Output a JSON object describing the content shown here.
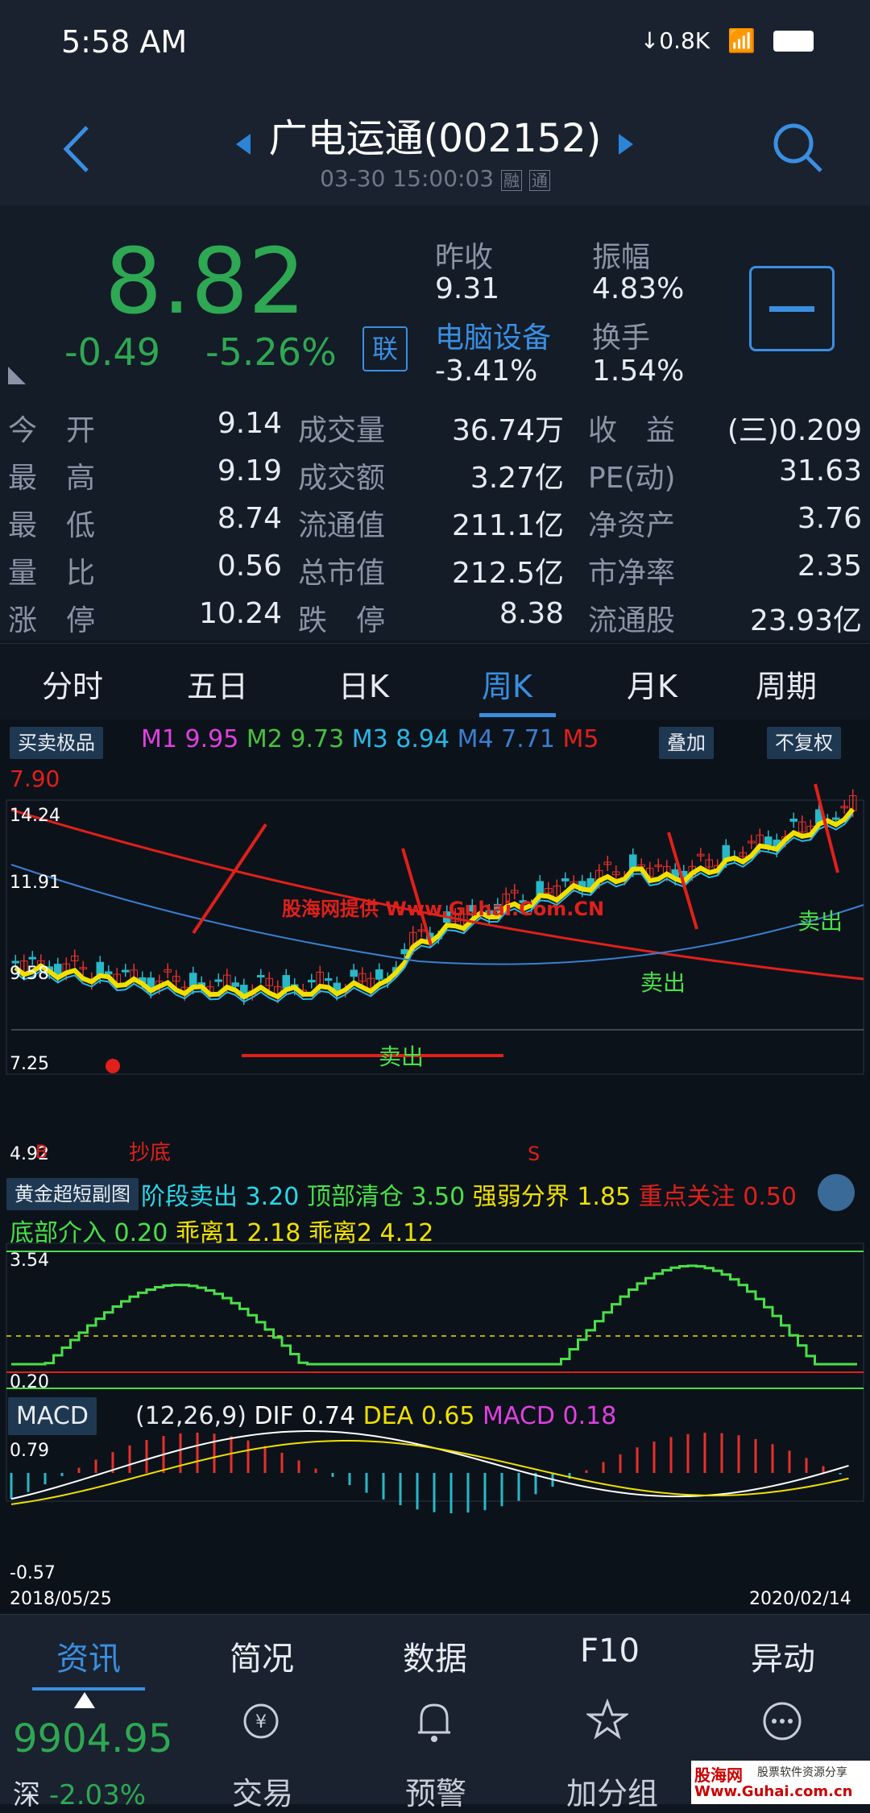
{
  "status": {
    "time": "5:58 AM",
    "carrier_icon": "signal-carrier-icon",
    "net_speed": "↓0.8K"
  },
  "header": {
    "title": "广电运通(002152)",
    "subtitle": "03-30 15:00:03",
    "badge1": "融",
    "badge2": "通"
  },
  "quote": {
    "price": "8.82",
    "change": "-0.49",
    "change_pct": "-5.26%",
    "tag": "联",
    "prev_close_label": "昨收",
    "prev_close": "9.31",
    "amplitude_label": "振幅",
    "amplitude": "4.83%",
    "sector_label": "电脑设备",
    "sector_change": "-3.41%",
    "turnover_label": "换手",
    "turnover": "1.54%"
  },
  "grid": [
    [
      "今　开",
      "9.14",
      "成交量",
      "36.74万",
      "收　益",
      "(三)0.209"
    ],
    [
      "最　高",
      "9.19",
      "成交额",
      "3.27亿",
      "PE(动)",
      "31.63"
    ],
    [
      "最　低",
      "8.74",
      "流通值",
      "211.1亿",
      "净资产",
      "3.76"
    ],
    [
      "量　比",
      "0.56",
      "总市值",
      "212.5亿",
      "市净率",
      "2.35"
    ],
    [
      "涨　停",
      "10.24",
      "跌　停",
      "8.38",
      "流通股",
      "23.93亿"
    ]
  ],
  "tabs": [
    "分时",
    "五日",
    "日K",
    "周K",
    "月K",
    "周期"
  ],
  "chart": {
    "indicator_chip": "买卖极品",
    "m1_label": "M1",
    "m1": "9.95",
    "m2_label": "M2",
    "m2": "9.73",
    "m3_label": "M3",
    "m3": "8.94",
    "m4_label": "M4",
    "m4": "7.71",
    "m5_label": "M5",
    "m5": "7.90",
    "overlay_btn": "叠加",
    "adjust_btn": "不复权",
    "y_ticks": [
      "14.24",
      "11.91",
      "9.58",
      "7.25",
      "4.92"
    ],
    "watermark": "股海网提供 Www.Guhai.Com.CN",
    "sell_label": "卖出",
    "bottom_label": "抄底",
    "s_label": "S",
    "b_label": "B",
    "sub_chip": "黄金超短副图",
    "sub_line1": [
      [
        "阶段卖出",
        "3.20"
      ],
      [
        "顶部清仓",
        "3.50"
      ],
      [
        "强弱分界",
        "1.85"
      ],
      [
        "重点关注",
        "0.50"
      ]
    ],
    "sub_line2": [
      [
        "底部介入",
        "0.20"
      ],
      [
        "乖离1",
        "2.18"
      ],
      [
        "乖离2",
        "4.12"
      ]
    ],
    "sub_ticks": [
      "3.54",
      "0.20"
    ],
    "macd_chip": "MACD",
    "macd_params": "(12,26,9)",
    "dif_label": "DIF",
    "dif": "0.74",
    "dea_label": "DEA",
    "dea": "0.65",
    "macd_label": "MACD",
    "macd": "0.18",
    "macd_ticks": [
      "0.79",
      "-0.57"
    ],
    "date_start": "2018/05/25",
    "date_end": "2020/02/14",
    "colors": {
      "up": "#e8302a",
      "down": "#28b8c8",
      "ma_red": "#e0201a",
      "ma_yellow": "#f0e000",
      "ma_blue": "#3a7fd0"
    }
  },
  "bottom_tabs": [
    "资讯",
    "简况",
    "数据",
    "F10",
    "异动"
  ],
  "bottom_nav": {
    "index_value": "9904.95",
    "index_name": "深",
    "index_change": "-2.03%",
    "items": [
      "交易",
      "预警",
      "加分组"
    ]
  },
  "ad": {
    "line1": "股海网",
    "line2": "股票软件资源分享",
    "line3": "Www.Guhai.com.cn"
  }
}
